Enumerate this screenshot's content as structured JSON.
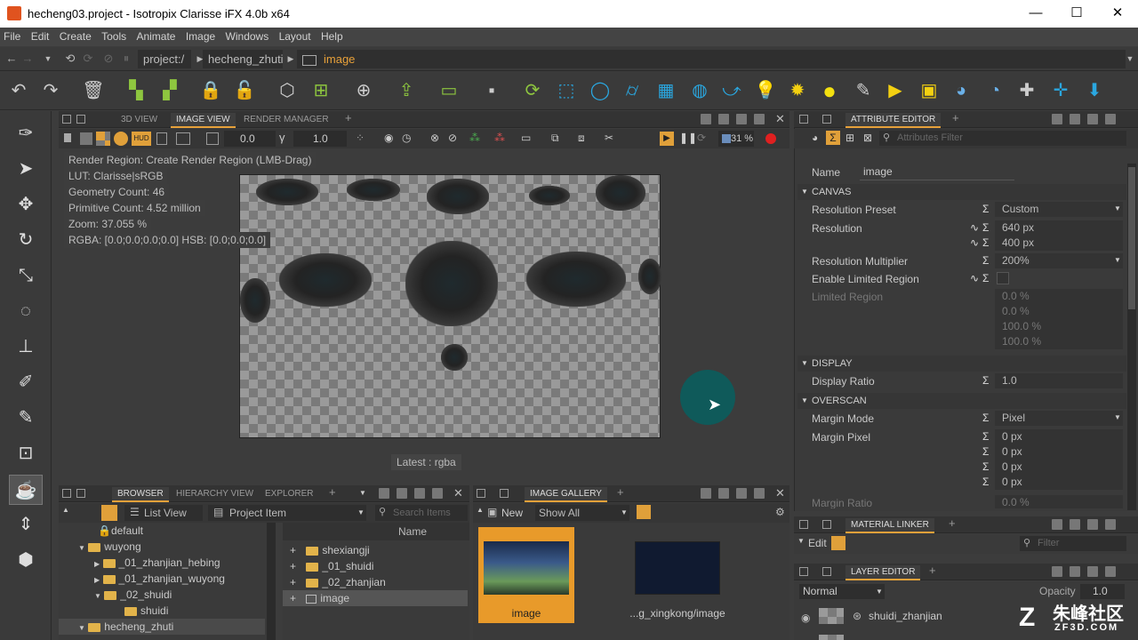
{
  "window": {
    "title": "hecheng03.project - Isotropix Clarisse iFX 4.0b x64",
    "minimize": "—",
    "maximize": "☐",
    "close": "✕"
  },
  "menu": [
    "File",
    "Edit",
    "Create",
    "Tools",
    "Animate",
    "Image",
    "Windows",
    "Layout",
    "Help"
  ],
  "nav": {
    "crumbs": [
      "project:/",
      "hecheng_zhuti",
      "image"
    ]
  },
  "viewport": {
    "tabs": [
      "3D VIEW",
      "IMAGE VIEW",
      "RENDER MANAGER"
    ],
    "active_tab": "IMAGE VIEW",
    "exposure": "0.0",
    "gamma": "1.0",
    "zoom_field": "31 %",
    "hud": [
      "Render Region: Create Render Region (LMB-Drag)",
      "LUT: Clarisse|sRGB",
      "Geometry Count: 46",
      "Primitive Count: 4.52 million",
      "Zoom: 37.055 %",
      "RGBA: [0.0;0.0;0.0;0.0] HSB: [0.0;0.0;0.0]"
    ],
    "latest": "Latest : rgba"
  },
  "attribute_editor": {
    "tab": "ATTRIBUTE EDITOR",
    "filter_placeholder": "Attributes Filter",
    "name_label": "Name",
    "name_value": "image",
    "sections": {
      "canvas": "CANVAS",
      "display": "DISPLAY",
      "overscan": "OVERSCAN"
    },
    "resolution_preset_label": "Resolution Preset",
    "resolution_preset_value": "Custom",
    "resolution_label": "Resolution",
    "resolution_w": "640 px",
    "resolution_h": "400 px",
    "res_mult_label": "Resolution Multiplier",
    "res_mult_value": "200%",
    "limited_region_label": "Enable Limited Region",
    "limited_region_sub": "Limited Region",
    "limited_values": [
      "0.0 %",
      "0.0 %",
      "100.0 %",
      "100.0 %"
    ],
    "display_ratio_label": "Display Ratio",
    "display_ratio_value": "1.0",
    "margin_mode_label": "Margin Mode",
    "margin_mode_value": "Pixel",
    "margin_pixel_label": "Margin Pixel",
    "margin_pixel_values": [
      "0 px",
      "0 px",
      "0 px",
      "0 px"
    ],
    "margin_ratio_label": "Margin Ratio",
    "margin_ratio_value": "0.0 %"
  },
  "material_linker": {
    "tab": "MATERIAL LINKER",
    "edit": "Edit",
    "filter_placeholder": "Filter"
  },
  "layer_editor": {
    "tab": "LAYER EDITOR",
    "blend": "Normal",
    "opacity_label": "Opacity",
    "opacity_value": "1.0",
    "layer_name": "shuidi_zhanjian"
  },
  "browser": {
    "tabs": [
      "BROWSER",
      "HIERARCHY VIEW",
      "EXPLORER"
    ],
    "active_tab": "BROWSER",
    "view_mode": "List View",
    "item_type": "Project Item",
    "search_placeholder": "Search Items",
    "tree": [
      "default",
      "wuyong",
      "_01_zhanjian_hebing",
      "_01_zhanjian_wuyong",
      "_02_shuidi",
      "shuidi",
      "hecheng_zhuti"
    ],
    "column_name": "Name",
    "list": [
      "shexiangji",
      "_01_shuidi",
      "_02_zhanjian",
      "image"
    ]
  },
  "gallery": {
    "tab": "IMAGE GALLERY",
    "new_label": "New",
    "filter_value": "Show All",
    "items": [
      "image",
      "...g_xingkong/image"
    ]
  },
  "watermark": {
    "text_cn": "朱峰社区",
    "text_en": "ZF3D.COM"
  }
}
